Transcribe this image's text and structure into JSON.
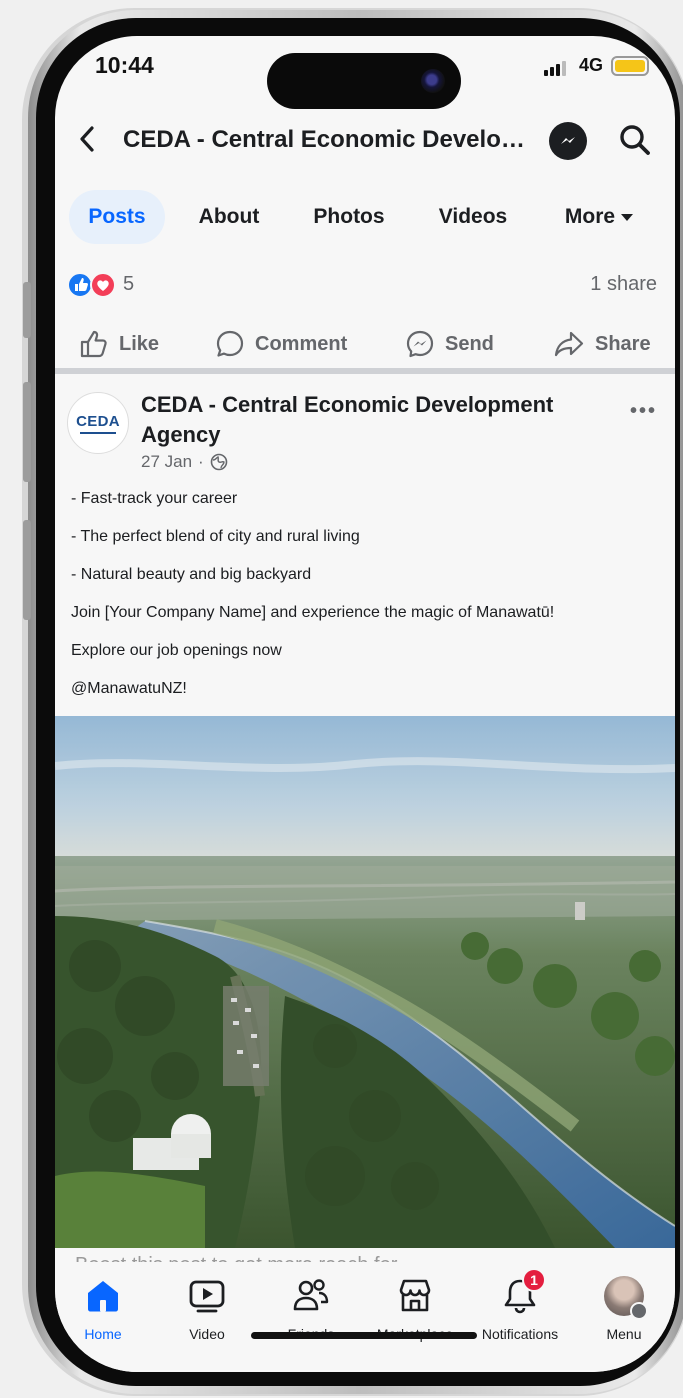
{
  "status_bar": {
    "time": "10:44",
    "network": "4G"
  },
  "header": {
    "title": "CEDA - Central Economic Development Agency"
  },
  "tabs": [
    {
      "label": "Posts",
      "active": true
    },
    {
      "label": "About"
    },
    {
      "label": "Photos"
    },
    {
      "label": "Videos"
    },
    {
      "label": "More"
    }
  ],
  "engagement": {
    "reaction_count": "5",
    "share_count": "1 share"
  },
  "actions": {
    "like": "Like",
    "comment": "Comment",
    "send": "Send",
    "share": "Share"
  },
  "post": {
    "avatar_text": "CEDA",
    "author": "CEDA - Central Economic Development Agency",
    "date": "27 Jan",
    "lines": [
      "-  Fast-track your career",
      "-  The perfect blend of city and rural living",
      "-  Natural beauty and big backyard",
      "Join [Your Company Name] and experience the magic of Manawatū!",
      "Explore our job openings now",
      "@ManawatuNZ!"
    ],
    "boost_text": "Boost this post to get more reach for"
  },
  "bottom_nav": {
    "home": "Home",
    "video": "Video",
    "friends": "Friends",
    "marketplace": "Marketplace",
    "notifications": "Notifications",
    "notifications_badge": "1",
    "menu": "Menu"
  },
  "colors": {
    "accent": "#0866ff",
    "badge": "#e41e3f",
    "text": "#1c1e21",
    "muted": "#65676b"
  }
}
